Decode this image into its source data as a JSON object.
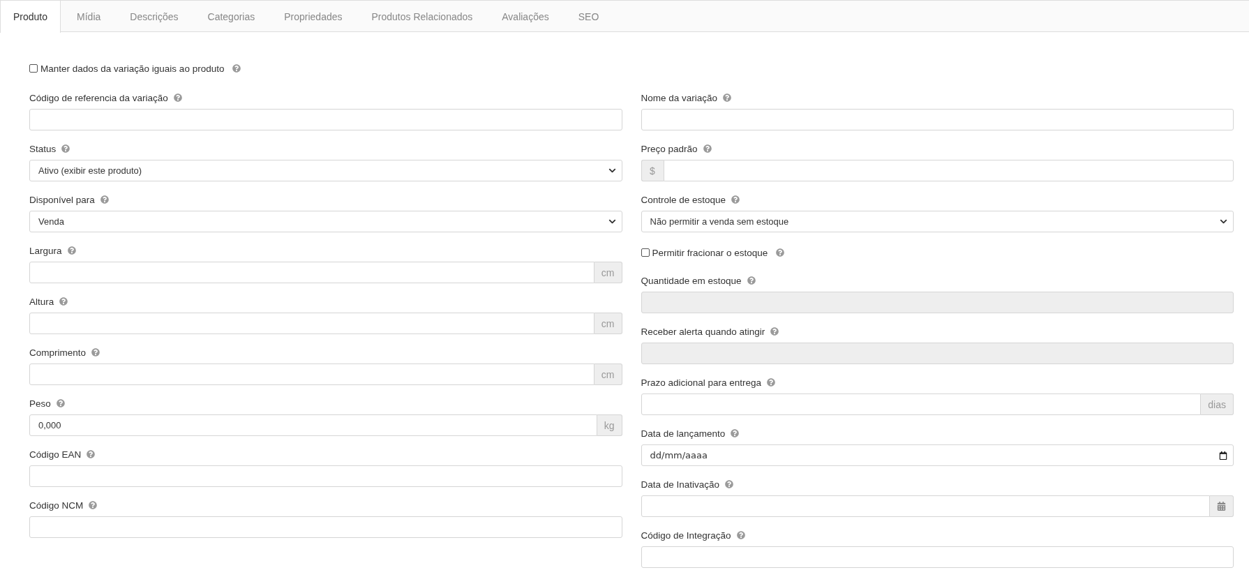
{
  "tabs": [
    {
      "label": "Produto",
      "selected": true
    },
    {
      "label": "Mídia",
      "selected": false
    },
    {
      "label": "Descrições",
      "selected": false
    },
    {
      "label": "Categorias",
      "selected": false
    },
    {
      "label": "Propriedades",
      "selected": false
    },
    {
      "label": "Produtos Relacionados",
      "selected": false
    },
    {
      "label": "Avaliações",
      "selected": false
    },
    {
      "label": "SEO",
      "selected": false
    }
  ],
  "top_checkbox": {
    "label": "Manter dados da variação iguais ao produto",
    "checked": false
  },
  "left_fields": [
    {
      "kind": "text",
      "label": "Código de referencia da variação"
    },
    {
      "kind": "select",
      "label": "Status",
      "value": "Ativo (exibir este produto)"
    },
    {
      "kind": "select",
      "label": "Disponível para",
      "value": "Venda"
    },
    {
      "kind": "suffix",
      "label": "Largura",
      "addon": "cm"
    },
    {
      "kind": "suffix",
      "label": "Altura",
      "addon": "cm"
    },
    {
      "kind": "suffix",
      "label": "Comprimento",
      "addon": "cm"
    },
    {
      "kind": "suffix",
      "label": "Peso",
      "value": "0,000",
      "addon": "kg"
    },
    {
      "kind": "text",
      "label": "Código EAN"
    },
    {
      "kind": "text",
      "label": "Código NCM"
    }
  ],
  "right_fields": [
    {
      "kind": "text",
      "label": "Nome da variação"
    },
    {
      "kind": "prefix",
      "label": "Preço padrão",
      "addon": "$"
    },
    {
      "kind": "select",
      "label": "Controle de estoque",
      "value": "Não permitir a venda sem estoque"
    },
    {
      "kind": "checkbox",
      "label": "Permitir fracionar o estoque",
      "checked": false
    },
    {
      "kind": "text",
      "label": "Quantidade em estoque",
      "disabled": true
    },
    {
      "kind": "text",
      "label": "Receber alerta quando atingir",
      "disabled": true
    },
    {
      "kind": "suffix",
      "label": "Prazo adicional para entrega",
      "addon": "dias"
    },
    {
      "kind": "date",
      "label": "Data de lançamento",
      "placeholder": "dd/mm/aaaa"
    },
    {
      "kind": "datepicker",
      "label": "Data de Inativação"
    },
    {
      "kind": "text",
      "label": "Código de Integração"
    }
  ]
}
